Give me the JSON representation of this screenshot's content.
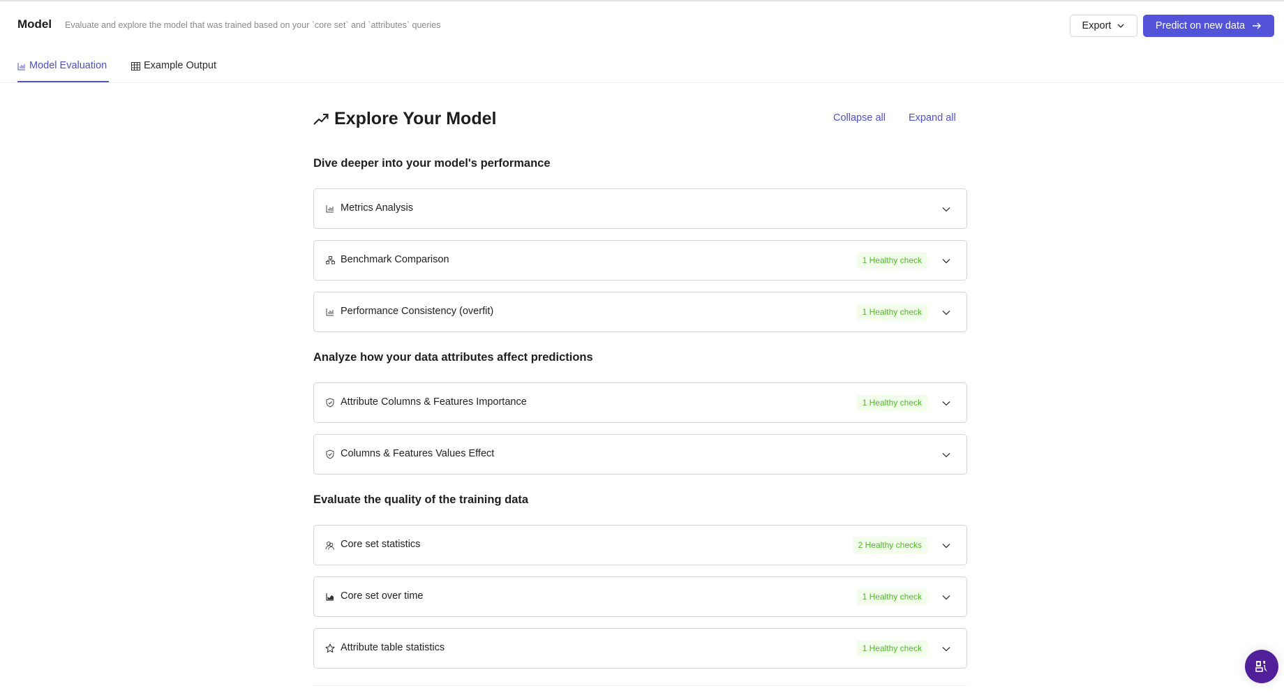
{
  "header": {
    "title": "Model",
    "subtitle": "Evaluate and explore the model that was trained based on your `core set` and `attributes` queries",
    "export_label": "Export",
    "predict_label": "Predict on new data"
  },
  "tabs": [
    {
      "label": "Model Evaluation",
      "icon": "bar-chart-icon",
      "active": true
    },
    {
      "label": "Example Output",
      "icon": "table-icon",
      "active": false
    }
  ],
  "main": {
    "title": "Explore Your Model",
    "title_icon": "trending-up-icon",
    "collapse_all": "Collapse all",
    "expand_all": "Expand all",
    "sections": [
      {
        "heading": "Dive deeper into your model's performance",
        "items": [
          {
            "label": "Metrics Analysis",
            "icon": "bar-chart-icon",
            "badge": null
          },
          {
            "label": "Benchmark Comparison",
            "icon": "hierarchy-icon",
            "badge": "1 Healthy check"
          },
          {
            "label": "Performance Consistency (overfit)",
            "icon": "bar-chart-icon",
            "badge": "1 Healthy check"
          }
        ]
      },
      {
        "heading": "Analyze how your data attributes affect predictions",
        "items": [
          {
            "label": "Attribute Columns & Features Importance",
            "icon": "shield-check-icon",
            "badge": "1 Healthy check"
          },
          {
            "label": "Columns & Features Values Effect",
            "icon": "shield-check-icon",
            "badge": null
          }
        ]
      },
      {
        "heading": "Evaluate the quality of the training data",
        "items": [
          {
            "label": "Core set statistics",
            "icon": "users-icon",
            "badge": "2 Healthy checks"
          },
          {
            "label": "Core set over time",
            "icon": "area-chart-icon",
            "badge": "1 Healthy check"
          },
          {
            "label": "Attribute table statistics",
            "icon": "star-icon",
            "badge": "1 Healthy check"
          }
        ]
      }
    ]
  },
  "colors": {
    "accent": "#5253d9",
    "link": "#4f4fc6",
    "healthy_text": "#52b52a",
    "healthy_bg": "#f2fdeb",
    "chat_button": "#521f9a"
  }
}
